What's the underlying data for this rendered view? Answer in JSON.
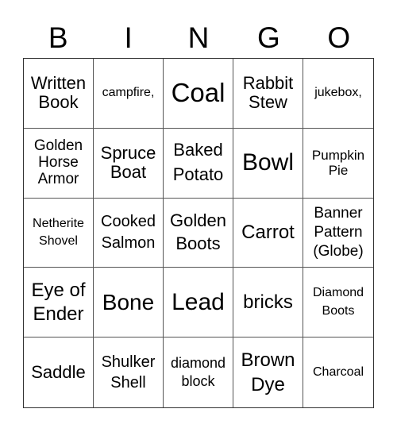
{
  "header": {
    "letters": [
      "B",
      "I",
      "N",
      "G",
      "O"
    ]
  },
  "board": {
    "rows": [
      [
        "Written Book",
        "campfire,",
        "Coal",
        "Rabbit Stew",
        "jukebox,"
      ],
      [
        "Golden Horse Armor",
        "Spruce Boat",
        "Baked Potato",
        "Bowl",
        "Pumpkin Pie"
      ],
      [
        "Netherite Shovel",
        "Cooked Salmon",
        "Golden Boots",
        "Carrot",
        "Banner Pattern (Globe)"
      ],
      [
        "Eye of Ender",
        "Bone",
        "Lead",
        "bricks",
        "Diamond Boots"
      ],
      [
        "Saddle",
        "Shulker Shell",
        "diamond block",
        "Brown Dye",
        "Charcoal"
      ]
    ]
  }
}
